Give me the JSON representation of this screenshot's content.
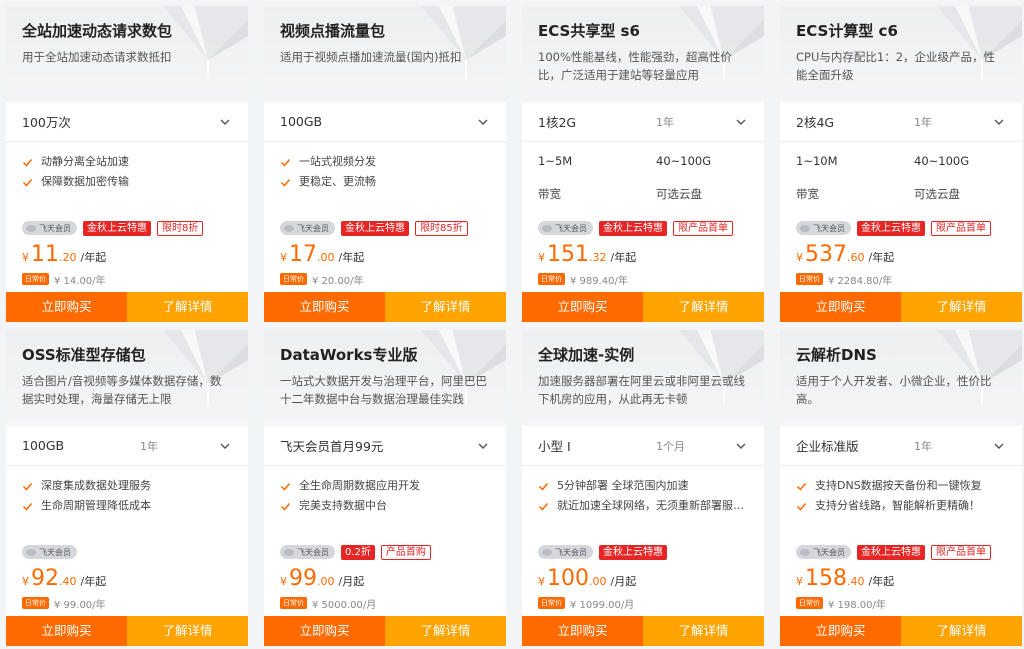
{
  "colors": {
    "accent": "#ff6a00",
    "detail": "#ffa300",
    "badge_red": "#e62525"
  },
  "icons": {
    "dropdown": "chevron-down-icon",
    "feature": "check-icon",
    "member": "member-icon"
  },
  "cards": [
    {
      "title": "全站加速动态请求数包",
      "desc": "用于全站加速动态请求数抵扣",
      "spec": "100万次",
      "duration": "",
      "features": [
        "动静分离全站加速",
        "保障数据加密传输"
      ],
      "specs": [],
      "member_badge": "飞天会员",
      "promo": "金秋上云特惠",
      "promo2": "限时8折",
      "currency": "¥",
      "price_int": "11",
      "price_dec": ".20",
      "price_unit": "/年起",
      "orig_tag": "日常价",
      "orig_price": "¥ 14.00/年",
      "buy": "立即购买",
      "detail": "了解详情"
    },
    {
      "title": "视频点播流量包",
      "desc": "适用于视频点播加速流量(国内)抵扣",
      "spec": "100GB",
      "duration": "",
      "features": [
        "一站式视频分发",
        "更稳定、更流畅"
      ],
      "specs": [],
      "member_badge": "飞天会员",
      "promo": "金秋上云特惠",
      "promo2": "限时85折",
      "currency": "¥",
      "price_int": "17",
      "price_dec": ".00",
      "price_unit": "/年起",
      "orig_tag": "日常价",
      "orig_price": "¥ 20.00/年",
      "buy": "立即购买",
      "detail": "了解详情"
    },
    {
      "title": "ECS共享型 s6",
      "desc": "100%性能基线，性能强劲，超高性价比，广泛适用于建站等轻量应用",
      "spec": "1核2G",
      "duration": "1年",
      "features": [],
      "specs": [
        [
          "1~5M",
          "40~100G"
        ],
        [
          "带宽",
          "可选云盘"
        ]
      ],
      "member_badge": "飞天会员",
      "promo": "金秋上云特惠",
      "promo2": "限产品首单",
      "currency": "¥",
      "price_int": "151",
      "price_dec": ".32",
      "price_unit": "/年起",
      "orig_tag": "日常价",
      "orig_price": "¥ 989.40/年",
      "buy": "立即购买",
      "detail": "了解详情"
    },
    {
      "title": "ECS计算型 c6",
      "desc": "CPU与内存配比1：2，企业级产品，性能全面升级",
      "spec": "2核4G",
      "duration": "1年",
      "features": [],
      "specs": [
        [
          "1~10M",
          "40~100G"
        ],
        [
          "带宽",
          "可选云盘"
        ]
      ],
      "member_badge": "飞天会员",
      "promo": "金秋上云特惠",
      "promo2": "限产品首单",
      "currency": "¥",
      "price_int": "537",
      "price_dec": ".60",
      "price_unit": "/年起",
      "orig_tag": "日常价",
      "orig_price": "¥ 2284.80/年",
      "buy": "立即购买",
      "detail": "了解详情"
    },
    {
      "title": "OSS标准型存储包",
      "desc": "适合图片/音视频等多媒体数据存储，数据实时处理，海量存储无上限",
      "spec": "100GB",
      "duration": "1年",
      "features": [
        "深度集成数据处理服务",
        "生命周期管理降低成本"
      ],
      "specs": [],
      "member_badge": "飞天会员",
      "promo": "",
      "promo2": "",
      "currency": "¥",
      "price_int": "92",
      "price_dec": ".40",
      "price_unit": "/年起",
      "orig_tag": "日常价",
      "orig_price": "¥ 99.00/年",
      "buy": "立即购买",
      "detail": "了解详情"
    },
    {
      "title": "DataWorks专业版",
      "desc": "一站式大数据开发与治理平台，阿里巴巴十二年数据中台与数据治理最佳实践",
      "spec": "飞天会员首月99元",
      "duration": "",
      "features": [
        "全生命周期数据应用开发",
        "完美支持数据中台"
      ],
      "specs": [],
      "member_badge": "飞天会员",
      "promo": "0.2折",
      "promo2": "产品首购",
      "currency": "¥",
      "price_int": "99",
      "price_dec": ".00",
      "price_unit": "/月起",
      "orig_tag": "日常价",
      "orig_price": "¥ 5000.00/月",
      "buy": "立即购买",
      "detail": "了解详情"
    },
    {
      "title": "全球加速-实例",
      "desc": "加速服务器部署在阿里云或非阿里云或线下机房的应用，从此再无卡顿",
      "spec": "小型 I",
      "duration": "1个月",
      "features": [
        "5分钟部署 全球范围内加速",
        "就近加速全球网络，无须重新部署服务..."
      ],
      "specs": [],
      "member_badge": "飞天会员",
      "promo": "金秋上云特惠",
      "promo2": "",
      "currency": "¥",
      "price_int": "100",
      "price_dec": ".00",
      "price_unit": "/月起",
      "orig_tag": "日常价",
      "orig_price": "¥ 1099.00/月",
      "buy": "立即购买",
      "detail": "了解详情"
    },
    {
      "title": "云解析DNS",
      "desc": "适用于个人开发者、小微企业，性价比高。",
      "spec": "企业标准版",
      "duration": "1年",
      "features": [
        "支持DNS数据按天备份和一键恢复",
        "支持分省线路，智能解析更精确！"
      ],
      "specs": [],
      "member_badge": "飞天会员",
      "promo": "金秋上云特惠",
      "promo2": "限产品首单",
      "currency": "¥",
      "price_int": "158",
      "price_dec": ".40",
      "price_unit": "/年起",
      "orig_tag": "日常价",
      "orig_price": "¥ 198.00/年",
      "buy": "立即购买",
      "detail": "了解详情"
    }
  ]
}
